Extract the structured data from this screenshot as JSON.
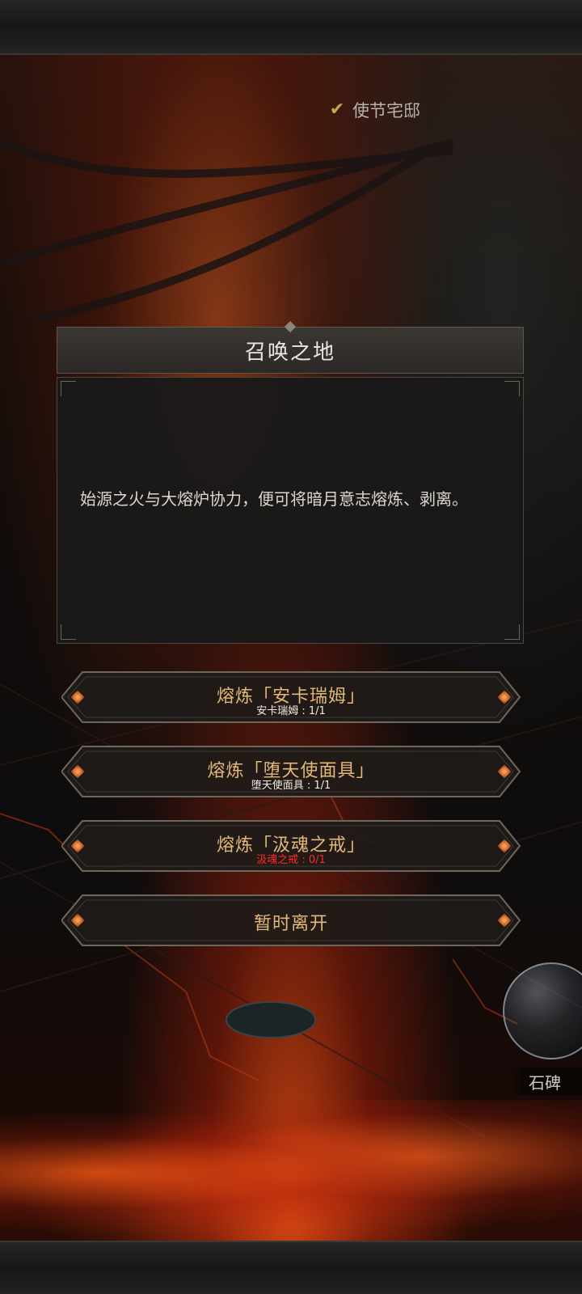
{
  "location": {
    "label": "使节宅邸",
    "icon": "check-icon"
  },
  "dialog": {
    "title": "召唤之地",
    "text": "始源之火与大熔炉协力，便可将暗月意志熔炼、剥离。"
  },
  "options": [
    {
      "label": "熔炼「安卡瑞姆」",
      "requirement": "安卡瑞姆 : 1/1",
      "met": true
    },
    {
      "label": "熔炼「堕天使面具」",
      "requirement": "堕天使面具 : 1/1",
      "met": true
    },
    {
      "label": "熔炼「汲魂之戒」",
      "requirement": "汲魂之戒 : 0/1",
      "met": false
    },
    {
      "label": "暂时离开"
    }
  ],
  "side_action": {
    "label": "石碑"
  },
  "colors": {
    "accent_gold": "#e3b878",
    "requirement_missing": "#ff2a22",
    "check_gold": "#c9a54e"
  }
}
